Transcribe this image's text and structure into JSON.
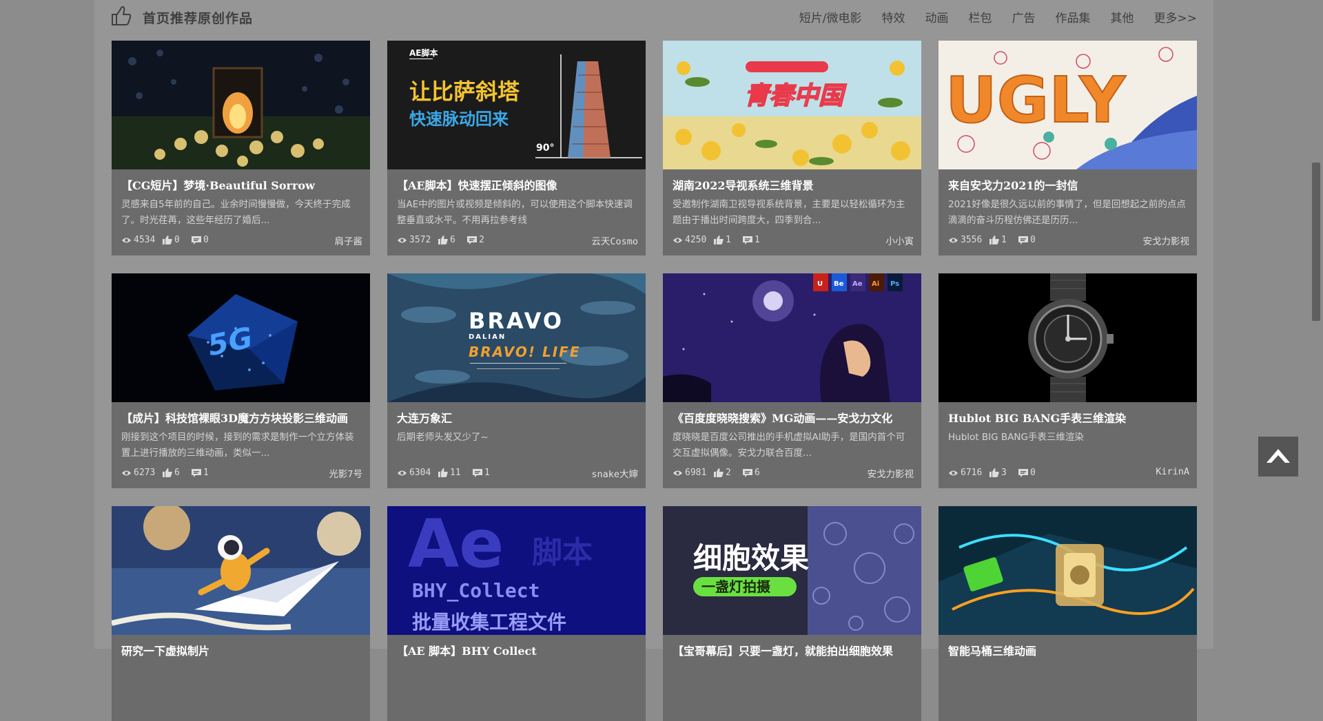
{
  "header": {
    "title": "首页推荐原创作品",
    "nav": [
      "短片/微电影",
      "特效",
      "动画",
      "栏包",
      "广告",
      "作品集",
      "其他",
      "更多>>"
    ]
  },
  "cards": [
    {
      "title": "【CG短片】梦境·Beautiful Sorrow",
      "desc": "灵感来自5年前的自己。业余时间慢慢做，今天终于完成了。时光荏苒，这些年经历了婚后...",
      "views": "4534",
      "likes": "0",
      "comments": "0",
      "author": "肩子酱"
    },
    {
      "title": "【AE脚本】快速摆正倾斜的图像",
      "desc": "当AE中的图片或视频是倾斜的，可以使用这个脚本快速调整垂直或水平。不用再拉参考线",
      "views": "3572",
      "likes": "6",
      "comments": "2",
      "author": "云天Cosmo",
      "thumb_tag": "AE脚本",
      "thumb_line1": "让比萨斜塔",
      "thumb_line2": "快速脉动回来",
      "thumb_angle": "90°"
    },
    {
      "title": "湖南2022导视系统三维背景",
      "desc": "受邀制作湖南卫视导视系统背景，主要是以轻松循环为主题由于播出时间跨度大，四季到合...",
      "views": "4250",
      "likes": "1",
      "comments": "1",
      "author": "小小寅",
      "thumb_text": "青春中国"
    },
    {
      "title": "来自安戈力2021的一封信",
      "desc": "2021好像是很久远以前的事情了，但是回想起之前的点点滴滴的奋斗历程仿佛还是历历...",
      "views": "3556",
      "likes": "1",
      "comments": "0",
      "author": "安戈力影视",
      "thumb_text": "UGLY"
    },
    {
      "title": "【成片】科技馆裸眼3D魔方方块投影三维动画",
      "desc": "刚接到这个项目的时候，接到的需求是制作一个立方体装置上进行播放的三维动画，类似一...",
      "views": "6273",
      "likes": "6",
      "comments": "1",
      "author": "光影7号",
      "thumb_text": "5G"
    },
    {
      "title": "大连万象汇",
      "desc": "后期老师头发又少了~",
      "views": "6304",
      "likes": "11",
      "comments": "1",
      "author": "snake大婶",
      "thumb_line1": "BRAVO",
      "thumb_line2": "DALIAN",
      "thumb_line3": "BRAVO! LIFE"
    },
    {
      "title": "《百度度晓晓搜索》MG动画——安戈力文化",
      "desc": "度晓晓是百度公司推出的手机虚拟AI助手，是国内首个可交互虚拟偶像。安戈力联合百度...",
      "views": "6981",
      "likes": "2",
      "comments": "6",
      "author": "安戈力影视",
      "thumb_badges": [
        "U",
        "Be",
        "Ae",
        "Ai",
        "Ps"
      ]
    },
    {
      "title": "Hublot BIG BANG手表三维渲染",
      "desc": "Hublot BIG BANG手表三维渲染",
      "views": "6716",
      "likes": "3",
      "comments": "0",
      "author": "KirinA"
    },
    {
      "title": "研究一下虚拟制片",
      "desc": "",
      "views": "",
      "likes": "",
      "comments": "",
      "author": ""
    },
    {
      "title": "【AE 脚本】BHY Collect",
      "desc": "",
      "views": "",
      "likes": "",
      "comments": "",
      "author": "",
      "thumb_line1": "Ae",
      "thumb_line2": "脚本",
      "thumb_line3": "BHY_Collect",
      "thumb_line4": "批量收集工程文件"
    },
    {
      "title": "【宝哥幕后】只要一盏灯，就能拍出细胞效果",
      "desc": "",
      "views": "",
      "likes": "",
      "comments": "",
      "author": "",
      "thumb_line1": "细胞效果",
      "thumb_line2": "一盏灯拍摄"
    },
    {
      "title": "智能马桶三维动画",
      "desc": "",
      "views": "",
      "likes": "",
      "comments": "",
      "author": ""
    }
  ],
  "colors": {
    "page_bg": "#969696",
    "card_bg": "#6b6b6b",
    "title_color": "#ffffff"
  }
}
